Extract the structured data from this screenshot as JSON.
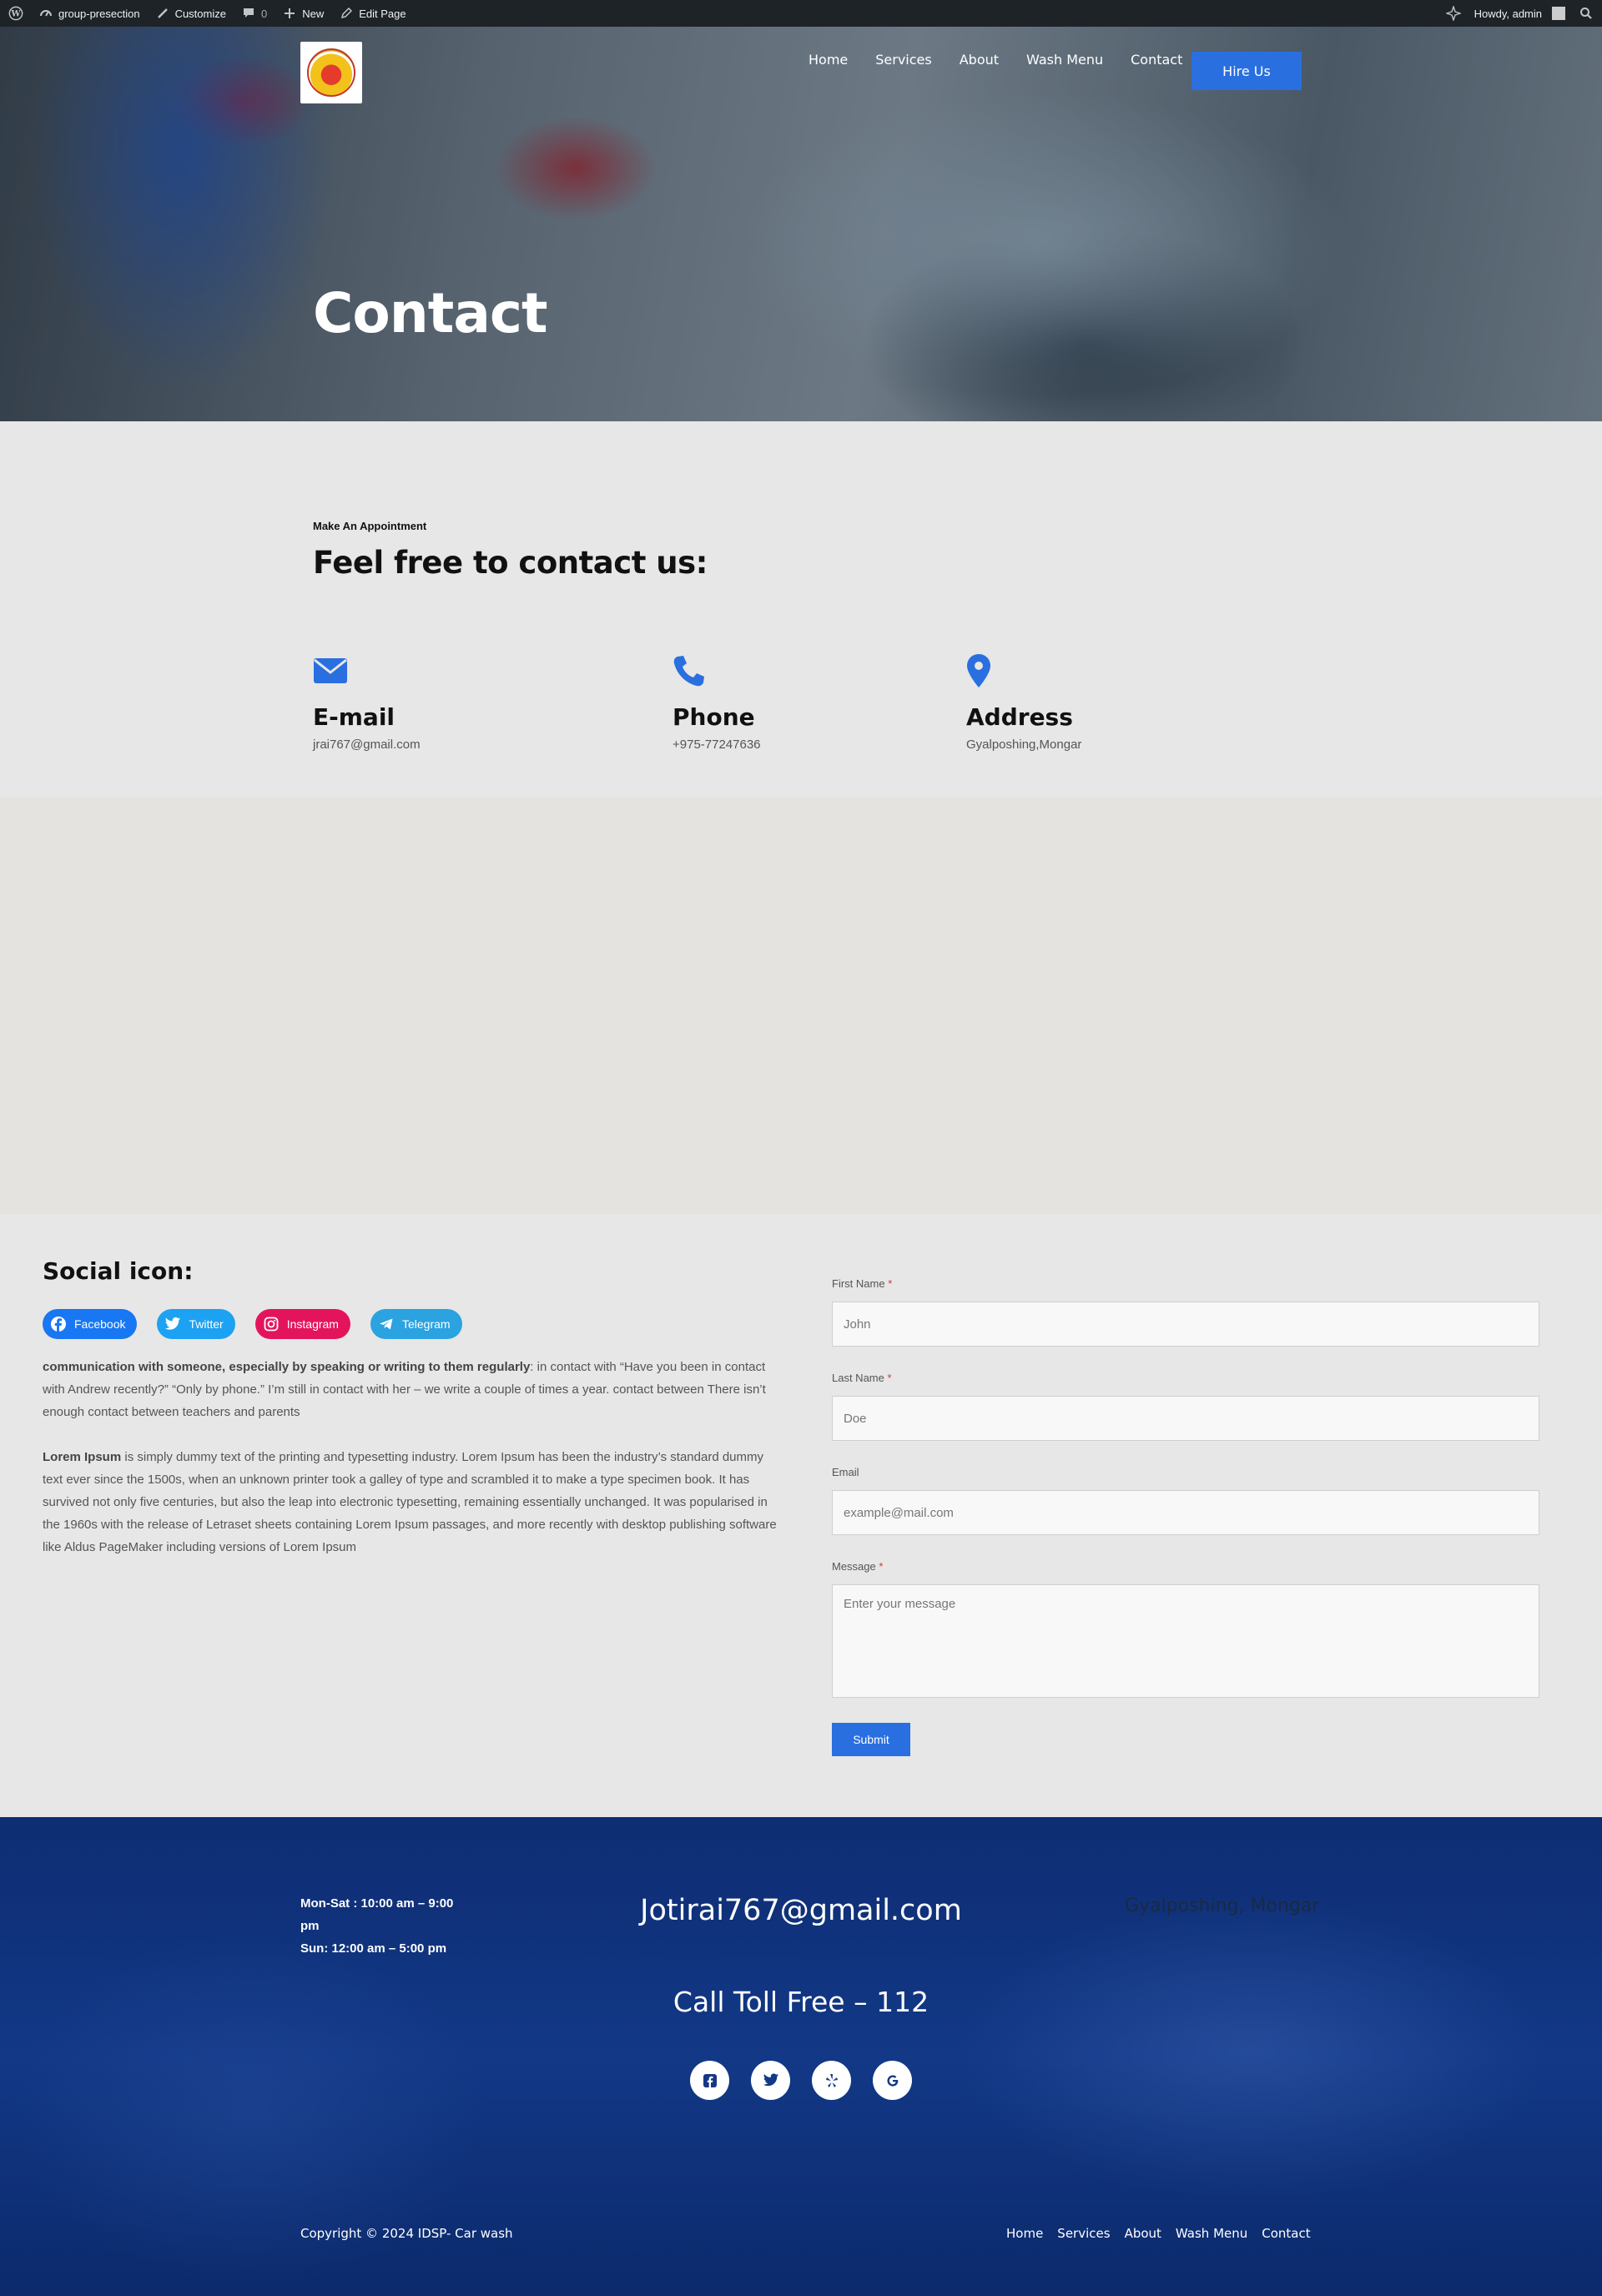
{
  "admin_bar": {
    "site_name": "group-presection",
    "customize": "Customize",
    "comments_count": "0",
    "new": "New",
    "edit_page": "Edit Page",
    "greeting": "Howdy, admin"
  },
  "header": {
    "nav": [
      "Home",
      "Services",
      "About",
      "Wash Menu",
      "Contact"
    ],
    "cta": "Hire Us"
  },
  "hero": {
    "title": "Contact"
  },
  "contact": {
    "eyebrow": "Make An Appointment",
    "title": "Feel free to contact us:",
    "items": [
      {
        "icon": "envelope-icon",
        "title": "E-mail",
        "value": "jrai767@gmail.com"
      },
      {
        "icon": "phone-icon",
        "title": "Phone",
        "value": "+975-77247636"
      },
      {
        "icon": "map-pin-icon",
        "title": "Address",
        "value": "Gyalposhing,Mongar"
      }
    ]
  },
  "social": {
    "title": "Social icon:",
    "buttons": [
      {
        "label": "Facebook",
        "icon": "facebook-icon",
        "color": "#1877f2"
      },
      {
        "label": "Twitter",
        "icon": "twitter-icon",
        "color": "#1da1f2"
      },
      {
        "label": "Instagram",
        "icon": "instagram-icon",
        "color": "#e4145c"
      },
      {
        "label": "Telegram",
        "icon": "telegram-icon",
        "color": "#2aa3e0"
      }
    ],
    "para1_bold": "communication with someone, especially by speaking or writing to them regularly",
    "para1_rest": ": in contact with “Have you been in contact with Andrew recently?” “Only by phone.” I’m still in contact with her – we write a couple of times a year. contact between There isn’t enough contact between teachers and parents",
    "para2_bold": "Lorem Ipsum",
    "para2_rest": " is simply dummy text of the printing and typesetting industry. Lorem Ipsum has been the industry’s standard dummy text ever since the 1500s, when an unknown printer took a galley of type and scrambled it to make a type specimen book. It has survived not only five centuries, but also the leap into electronic typesetting, remaining essentially unchanged. It was popularised in the 1960s with the release of Letraset sheets containing Lorem Ipsum passages, and more recently with desktop publishing software like Aldus PageMaker including versions of Lorem Ipsum"
  },
  "form": {
    "first_name_label": "First Name",
    "first_name_placeholder": "John",
    "last_name_label": "Last Name",
    "last_name_placeholder": "Doe",
    "email_label": "Email",
    "email_placeholder": "example@mail.com",
    "message_label": "Message",
    "message_placeholder": "Enter your message",
    "required_mark": "*",
    "submit": "Submit"
  },
  "footer": {
    "hours_line1": "Mon-Sat : 10:00 am – 9:00 pm",
    "hours_line2": "Sun: 12:00 am – 5:00 pm",
    "email": "Jotirai767@gmail.com",
    "address": "Gyalposhing, Mongar",
    "toll": "Call Toll Free – 112",
    "social_icons": [
      "facebook-square-icon",
      "twitter-icon",
      "yelp-icon",
      "google-icon"
    ],
    "copyright": "Copyright © 2024 IDSP- Car wash",
    "nav": [
      "Home",
      "Services",
      "About",
      "Wash Menu",
      "Contact"
    ]
  },
  "colors": {
    "accent": "#2a6fe0",
    "footer_bg": "#123886",
    "admin_bar": "#1d2327"
  }
}
